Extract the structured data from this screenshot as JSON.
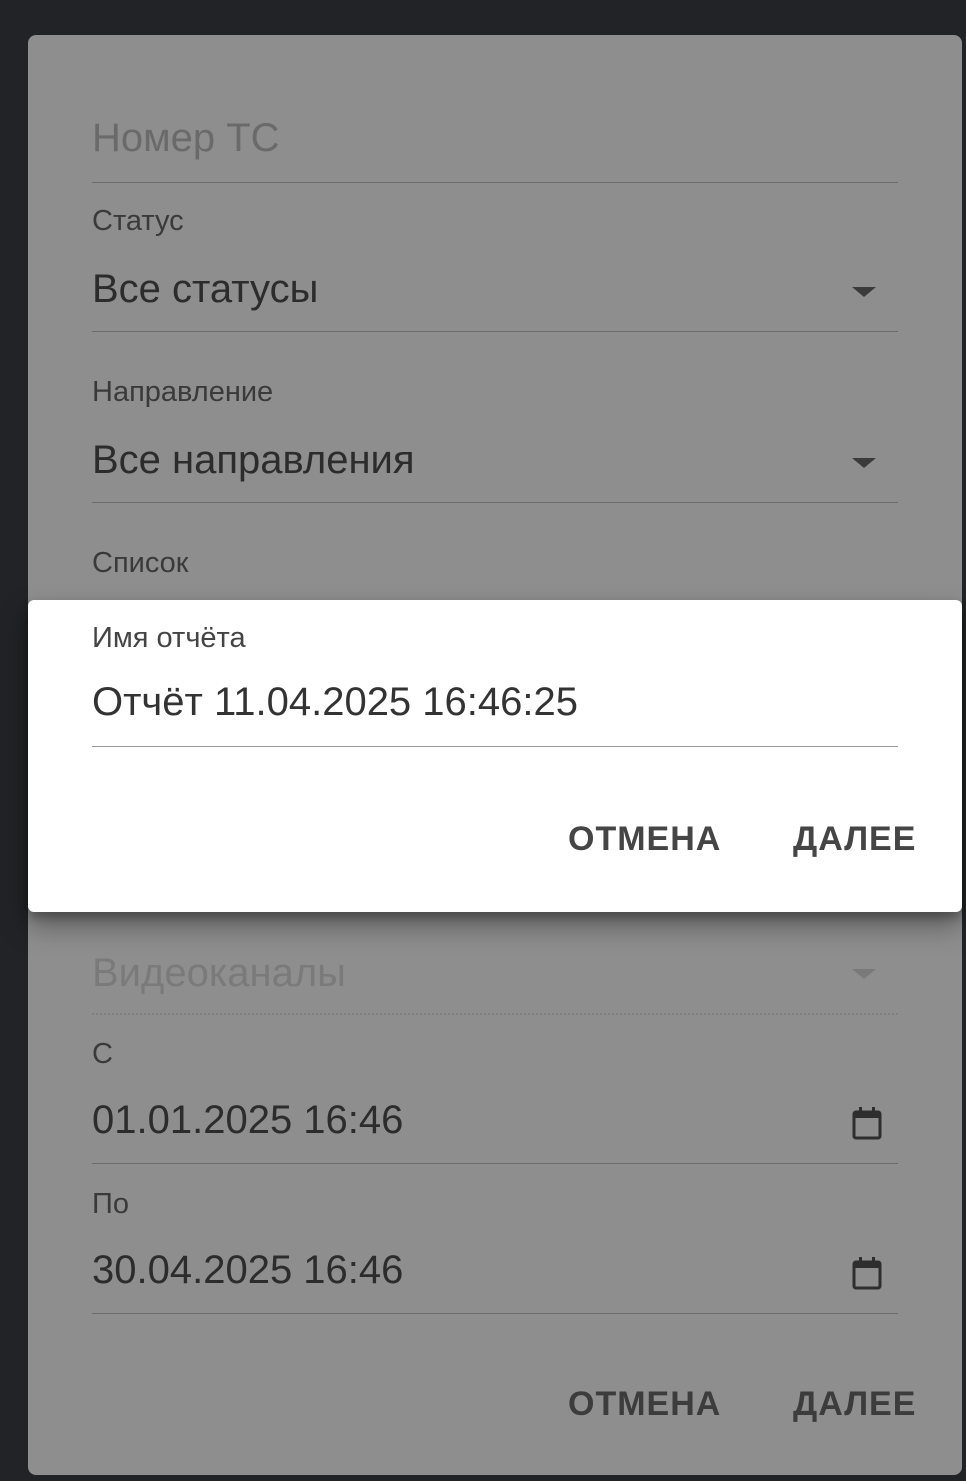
{
  "form": {
    "vehicle_number": {
      "placeholder": "Номер ТС"
    },
    "status": {
      "label": "Статус",
      "value": "Все статусы"
    },
    "direction": {
      "label": "Направление",
      "value": "Все направления"
    },
    "list": {
      "label": "Список"
    },
    "video_channels": {
      "placeholder": "Видеоканалы"
    },
    "date_from": {
      "label": "С",
      "value": "01.01.2025 16:46"
    },
    "date_to": {
      "label": "По",
      "value": "30.04.2025 16:46"
    },
    "cancel_label": "ОТМЕНА",
    "next_label": "ДАЛЕЕ"
  },
  "report_dialog": {
    "name_label": "Имя отчёта",
    "name_value": "Отчёт 11.04.2025 16:46:25",
    "cancel_label": "ОТМЕНА",
    "next_label": "ДАЛЕЕ"
  },
  "icons": [
    "chevron-down-icon",
    "calendar-icon"
  ],
  "colors": {
    "backdrop": "#222326",
    "dimmed_dialog": "#8e8e8e",
    "active_dialog": "#ffffff"
  }
}
